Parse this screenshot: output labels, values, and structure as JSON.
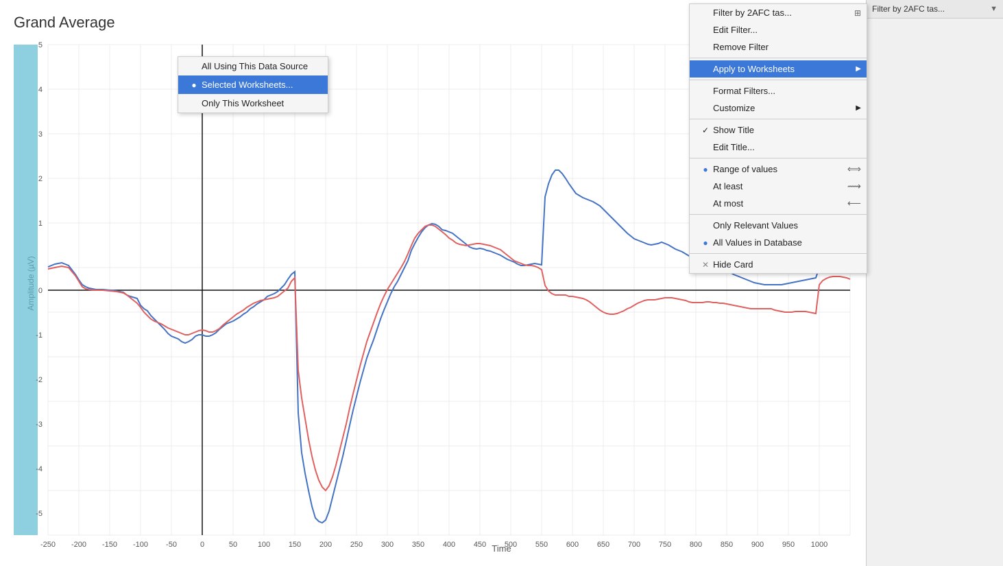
{
  "chart": {
    "title": "Grand Average",
    "x_axis_label": "Time",
    "y_axis_label": "Amplitude (µV)",
    "x_ticks": [
      "-250",
      "-200",
      "-150",
      "-100",
      "-50",
      "0",
      "50",
      "100",
      "150",
      "200",
      "250",
      "300",
      "350",
      "400",
      "450",
      "500",
      "550",
      "600",
      "650",
      "700",
      "750",
      "800",
      "850",
      "900",
      "950",
      "1000"
    ],
    "y_ticks": [
      "5",
      "4",
      "3",
      "2",
      "1",
      "0",
      "-1",
      "-2",
      "-3",
      "-4",
      "-5"
    ],
    "accent_bar_color": "#5fbcd3"
  },
  "filter_header": {
    "label": "Filter by 2AFC tas...",
    "icon": "▼"
  },
  "context_menu": {
    "items": [
      {
        "id": "filter-by",
        "label": "Filter by 2AFC tas...",
        "type": "header",
        "shortcut_icon": "⊞",
        "arrow": ""
      },
      {
        "id": "edit-filter",
        "label": "Edit Filter...",
        "type": "item"
      },
      {
        "id": "remove-filter",
        "label": "Remove Filter",
        "type": "item"
      },
      {
        "id": "apply-to-worksheets",
        "label": "Apply to Worksheets",
        "type": "item-arrow",
        "highlighted": true
      },
      {
        "id": "format-filters",
        "label": "Format Filters...",
        "type": "item"
      },
      {
        "id": "customize",
        "label": "Customize",
        "type": "item-arrow"
      },
      {
        "id": "show-title",
        "label": "Show Title",
        "type": "item-check",
        "checked": true
      },
      {
        "id": "edit-title",
        "label": "Edit Title...",
        "type": "item"
      },
      {
        "id": "range-of-values",
        "label": "Range of values",
        "type": "item-bullet-icon",
        "bullet": true
      },
      {
        "id": "at-least",
        "label": "At least",
        "type": "item-bullet-icon2"
      },
      {
        "id": "at-most",
        "label": "At most",
        "type": "item-bullet-icon3"
      },
      {
        "id": "only-relevant",
        "label": "Only Relevant Values",
        "type": "item"
      },
      {
        "id": "all-values",
        "label": "All Values in Database",
        "type": "item-bullet",
        "bullet": true
      },
      {
        "id": "hide-card",
        "label": "Hide Card",
        "type": "item-x"
      }
    ]
  },
  "submenu": {
    "items": [
      {
        "id": "all-using",
        "label": "All Using This Data Source",
        "type": "item"
      },
      {
        "id": "selected-worksheets",
        "label": "Selected Worksheets...",
        "type": "item-active",
        "bullet": true
      },
      {
        "id": "only-this",
        "label": "Only This Worksheet",
        "type": "item"
      }
    ]
  }
}
